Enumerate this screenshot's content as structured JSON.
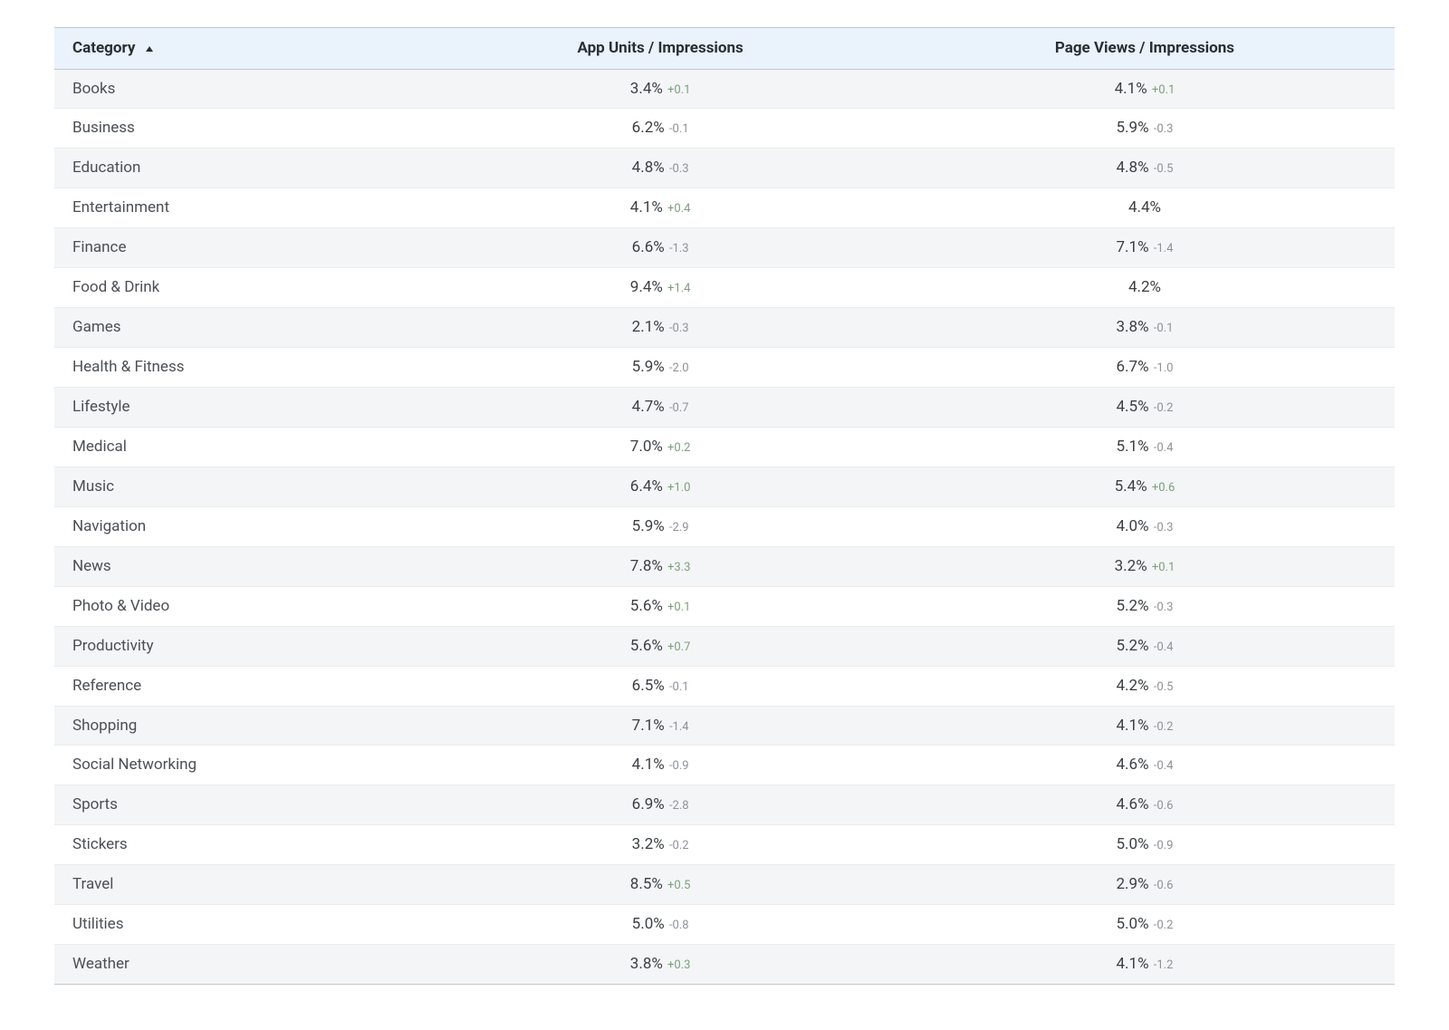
{
  "table": {
    "headers": {
      "category": "Category",
      "app_units": "App Units / Impressions",
      "page_views": "Page Views / Impressions"
    },
    "sort": {
      "column": 0,
      "direction": "asc"
    },
    "rows": [
      {
        "category": "Books",
        "app_units": "3.4%",
        "app_delta": "+0.1",
        "page_views": "4.1%",
        "page_delta": "+0.1"
      },
      {
        "category": "Business",
        "app_units": "6.2%",
        "app_delta": "-0.1",
        "page_views": "5.9%",
        "page_delta": "-0.3"
      },
      {
        "category": "Education",
        "app_units": "4.8%",
        "app_delta": "-0.3",
        "page_views": "4.8%",
        "page_delta": "-0.5"
      },
      {
        "category": "Entertainment",
        "app_units": "4.1%",
        "app_delta": "+0.4",
        "page_views": "4.4%",
        "page_delta": ""
      },
      {
        "category": "Finance",
        "app_units": "6.6%",
        "app_delta": "-1.3",
        "page_views": "7.1%",
        "page_delta": "-1.4"
      },
      {
        "category": "Food & Drink",
        "app_units": "9.4%",
        "app_delta": "+1.4",
        "page_views": "4.2%",
        "page_delta": ""
      },
      {
        "category": "Games",
        "app_units": "2.1%",
        "app_delta": "-0.3",
        "page_views": "3.8%",
        "page_delta": "-0.1"
      },
      {
        "category": "Health & Fitness",
        "app_units": "5.9%",
        "app_delta": "-2.0",
        "page_views": "6.7%",
        "page_delta": "-1.0"
      },
      {
        "category": "Lifestyle",
        "app_units": "4.7%",
        "app_delta": "-0.7",
        "page_views": "4.5%",
        "page_delta": "-0.2"
      },
      {
        "category": "Medical",
        "app_units": "7.0%",
        "app_delta": "+0.2",
        "page_views": "5.1%",
        "page_delta": "-0.4"
      },
      {
        "category": "Music",
        "app_units": "6.4%",
        "app_delta": "+1.0",
        "page_views": "5.4%",
        "page_delta": "+0.6"
      },
      {
        "category": "Navigation",
        "app_units": "5.9%",
        "app_delta": "-2.9",
        "page_views": "4.0%",
        "page_delta": "-0.3"
      },
      {
        "category": "News",
        "app_units": "7.8%",
        "app_delta": "+3.3",
        "page_views": "3.2%",
        "page_delta": "+0.1"
      },
      {
        "category": "Photo & Video",
        "app_units": "5.6%",
        "app_delta": "+0.1",
        "page_views": "5.2%",
        "page_delta": "-0.3"
      },
      {
        "category": "Productivity",
        "app_units": "5.6%",
        "app_delta": "+0.7",
        "page_views": "5.2%",
        "page_delta": "-0.4"
      },
      {
        "category": "Reference",
        "app_units": "6.5%",
        "app_delta": "-0.1",
        "page_views": "4.2%",
        "page_delta": "-0.5"
      },
      {
        "category": "Shopping",
        "app_units": "7.1%",
        "app_delta": "-1.4",
        "page_views": "4.1%",
        "page_delta": "-0.2"
      },
      {
        "category": "Social Networking",
        "app_units": "4.1%",
        "app_delta": "-0.9",
        "page_views": "4.6%",
        "page_delta": "-0.4"
      },
      {
        "category": "Sports",
        "app_units": "6.9%",
        "app_delta": "-2.8",
        "page_views": "4.6%",
        "page_delta": "-0.6"
      },
      {
        "category": "Stickers",
        "app_units": "3.2%",
        "app_delta": "-0.2",
        "page_views": "5.0%",
        "page_delta": "-0.9"
      },
      {
        "category": "Travel",
        "app_units": "8.5%",
        "app_delta": "+0.5",
        "page_views": "2.9%",
        "page_delta": "-0.6"
      },
      {
        "category": "Utilities",
        "app_units": "5.0%",
        "app_delta": "-0.8",
        "page_views": "5.0%",
        "page_delta": "-0.2"
      },
      {
        "category": "Weather",
        "app_units": "3.8%",
        "app_delta": "+0.3",
        "page_views": "4.1%",
        "page_delta": "-1.2"
      }
    ]
  },
  "chart_data": {
    "type": "table",
    "title": "",
    "columns": [
      "Category",
      "App Units / Impressions (%)",
      "Δ App",
      "Page Views / Impressions (%)",
      "Δ Page"
    ],
    "rows": [
      [
        "Books",
        3.4,
        0.1,
        4.1,
        0.1
      ],
      [
        "Business",
        6.2,
        -0.1,
        5.9,
        -0.3
      ],
      [
        "Education",
        4.8,
        -0.3,
        4.8,
        -0.5
      ],
      [
        "Entertainment",
        4.1,
        0.4,
        4.4,
        null
      ],
      [
        "Finance",
        6.6,
        -1.3,
        7.1,
        -1.4
      ],
      [
        "Food & Drink",
        9.4,
        1.4,
        4.2,
        null
      ],
      [
        "Games",
        2.1,
        -0.3,
        3.8,
        -0.1
      ],
      [
        "Health & Fitness",
        5.9,
        -2.0,
        6.7,
        -1.0
      ],
      [
        "Lifestyle",
        4.7,
        -0.7,
        4.5,
        -0.2
      ],
      [
        "Medical",
        7.0,
        0.2,
        5.1,
        -0.4
      ],
      [
        "Music",
        6.4,
        1.0,
        5.4,
        0.6
      ],
      [
        "Navigation",
        5.9,
        -2.9,
        4.0,
        -0.3
      ],
      [
        "News",
        7.8,
        3.3,
        3.2,
        0.1
      ],
      [
        "Photo & Video",
        5.6,
        0.1,
        5.2,
        -0.3
      ],
      [
        "Productivity",
        5.6,
        0.7,
        5.2,
        -0.4
      ],
      [
        "Reference",
        6.5,
        -0.1,
        4.2,
        -0.5
      ],
      [
        "Shopping",
        7.1,
        -1.4,
        4.1,
        -0.2
      ],
      [
        "Social Networking",
        4.1,
        -0.9,
        4.6,
        -0.4
      ],
      [
        "Sports",
        6.9,
        -2.8,
        4.6,
        -0.6
      ],
      [
        "Stickers",
        3.2,
        -0.2,
        5.0,
        -0.9
      ],
      [
        "Travel",
        8.5,
        0.5,
        2.9,
        -0.6
      ],
      [
        "Utilities",
        5.0,
        -0.8,
        5.0,
        -0.2
      ],
      [
        "Weather",
        3.8,
        0.3,
        4.1,
        -1.2
      ]
    ]
  }
}
